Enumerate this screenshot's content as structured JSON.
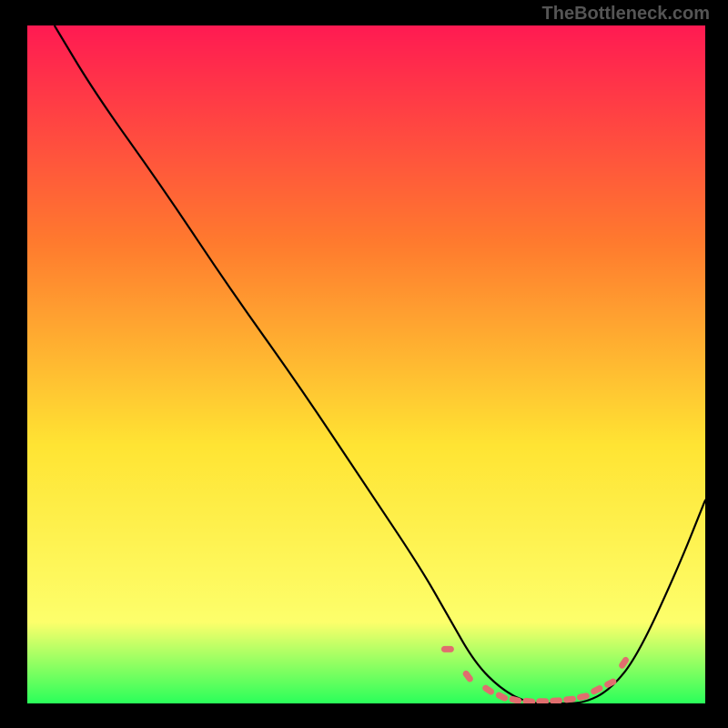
{
  "watermark": "TheBottleneck.com",
  "chart_data": {
    "type": "line",
    "title": "",
    "xlabel": "",
    "ylabel": "",
    "xlim": [
      0,
      100
    ],
    "ylim": [
      0,
      100
    ],
    "gradient": {
      "top": "#ff1a52",
      "mid_upper": "#ff7a2e",
      "mid": "#ffe433",
      "mid_lower": "#fdff6b",
      "bottom": "#2aff5a"
    },
    "series": [
      {
        "name": "bottleneck-curve",
        "color": "#000000",
        "x": [
          4,
          10,
          20,
          30,
          40,
          50,
          58,
          62,
          66,
          70,
          74,
          78,
          82,
          86,
          90,
          96,
          100
        ],
        "y": [
          100,
          90,
          76,
          61,
          47,
          32,
          20,
          13,
          6,
          2,
          0,
          0,
          0,
          2,
          7,
          20,
          30
        ]
      }
    ],
    "markers": {
      "name": "optimal-range-dots",
      "color": "#e06e6e",
      "x": [
        62,
        65,
        68,
        70,
        72,
        74,
        76,
        78,
        80,
        82,
        84,
        86,
        88
      ],
      "y": [
        8,
        4,
        2,
        1,
        0.5,
        0.3,
        0.3,
        0.4,
        0.6,
        1,
        2,
        3,
        6
      ]
    }
  }
}
